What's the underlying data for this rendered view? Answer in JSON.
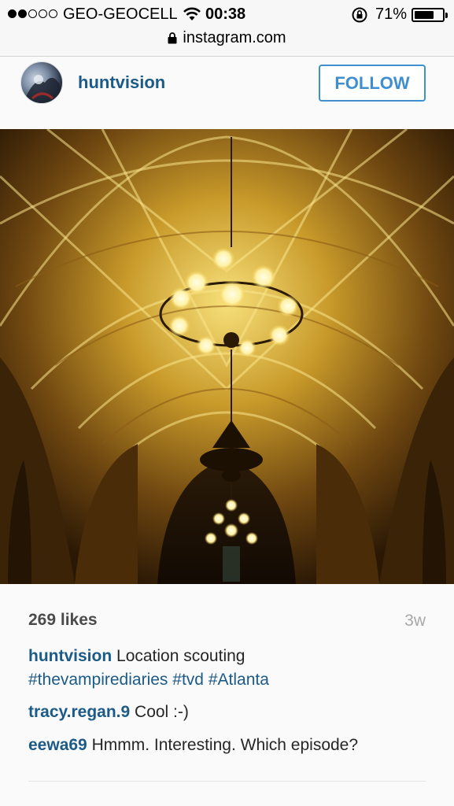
{
  "status_bar": {
    "carrier": "GEO-GEOCELL",
    "time": "00:38",
    "battery_percent": "71%",
    "battery_level": 0.71,
    "signal_bars_filled": 2,
    "signal_bars_total": 5
  },
  "browser": {
    "url": "instagram.com"
  },
  "post": {
    "username": "huntvision",
    "follow_label": "FOLLOW",
    "likes": "269 likes",
    "age": "3w",
    "caption": {
      "author": "huntvision",
      "text": "Location scouting",
      "hashtags": [
        "#thevampirediaries",
        "#tvd",
        "#Atlanta"
      ]
    },
    "comments": [
      {
        "author": "tracy.regan.9",
        "text": "Cool :-)"
      },
      {
        "author": "eewa69",
        "text": "Hmmm. Interesting. Which episode?"
      }
    ]
  },
  "colors": {
    "link_blue": "#1c5a87",
    "follow_blue": "#3f8fd0"
  }
}
